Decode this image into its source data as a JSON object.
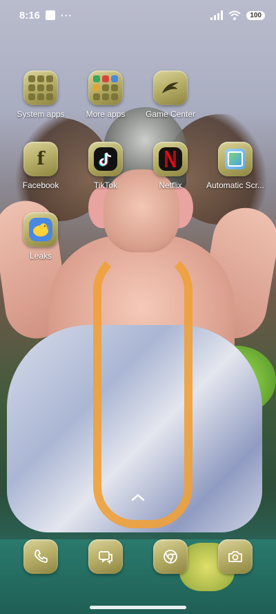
{
  "status_bar": {
    "time": "8:16",
    "more_indicator": "···",
    "battery": "100"
  },
  "apps": [
    {
      "label": "System apps",
      "icon": "folder-icon"
    },
    {
      "label": "More apps",
      "icon": "folder-icon"
    },
    {
      "label": "Game Center",
      "icon": "game-center-icon"
    },
    {
      "label": "Facebook",
      "icon": "facebook-icon"
    },
    {
      "label": "TikTok",
      "icon": "tiktok-icon"
    },
    {
      "label": "Netflix",
      "icon": "netflix-icon"
    },
    {
      "label": "Automatic Scr...",
      "icon": "automatic-screen-icon"
    },
    {
      "label": "Leaks",
      "icon": "leaks-icon"
    }
  ],
  "dock": [
    {
      "icon": "phone-icon"
    },
    {
      "icon": "messages-icon"
    },
    {
      "icon": "browser-icon"
    },
    {
      "icon": "camera-icon"
    }
  ],
  "colors": {
    "icon_theme_gold": "#c9c182",
    "netflix_red": "#e50914",
    "tiktok_black": "#111111"
  }
}
